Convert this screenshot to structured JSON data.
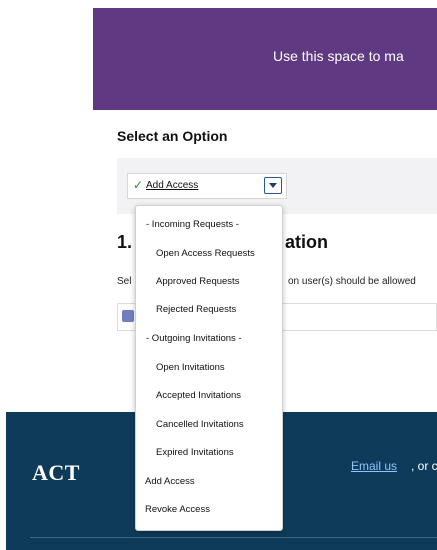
{
  "banner": {
    "text": "Use this space to ma"
  },
  "option_section": {
    "title": "Select an Option",
    "selected_value": "Add Access"
  },
  "step": {
    "number": "1.",
    "title_fragment": "ation",
    "description_left": "Sel",
    "description_right": "on user(s) should be allowed"
  },
  "dropdown": {
    "incoming_header": "- Incoming Requests -",
    "open_access_requests": "Open Access Requests",
    "approved_requests": "Approved Requests",
    "rejected_requests": "Rejected Requests",
    "outgoing_header": "- Outgoing Invitations -",
    "open_invitations": "Open Invitations",
    "accepted_invitations": "Accepted Invitations",
    "cancelled_invitations": "Cancelled Invitations",
    "expired_invitations": "Expired Invitations",
    "add_access": "Add Access",
    "revoke_access": "Revoke Access"
  },
  "footer": {
    "logo": "ACT",
    "email_link": "Email us",
    "link_tail": ", or c"
  },
  "colors": {
    "banner": "#5f3a82",
    "footer": "#0f3b5b",
    "check": "#2e8b3a",
    "link": "#8ec5ff"
  }
}
